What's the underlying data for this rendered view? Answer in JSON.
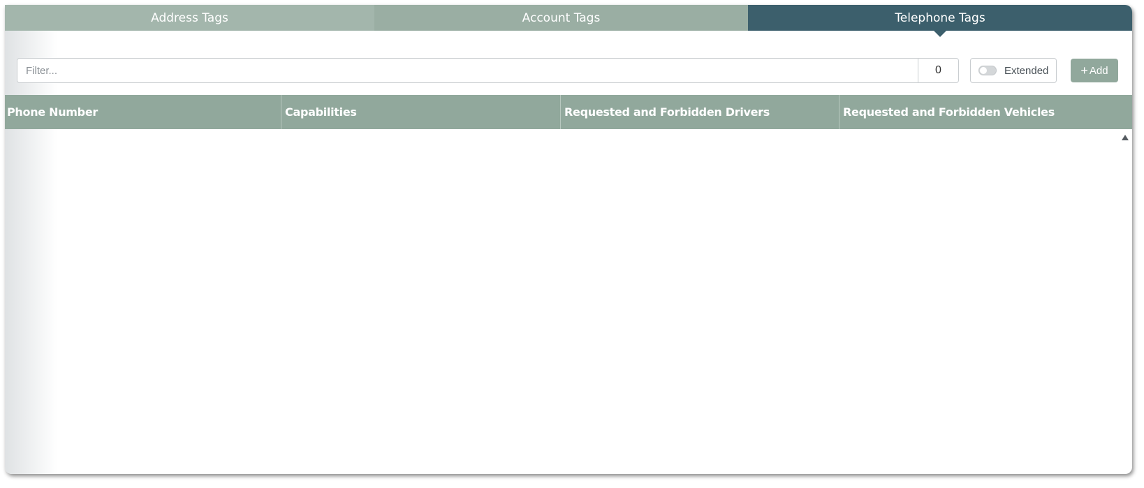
{
  "tabs": [
    {
      "label": "Address Tags",
      "active": false
    },
    {
      "label": "Account Tags",
      "active": false
    },
    {
      "label": "Telephone Tags",
      "active": true
    }
  ],
  "toolbar": {
    "filter_placeholder": "Filter...",
    "filter_value": "",
    "count": "0",
    "extended_label": "Extended",
    "extended_on": false,
    "add_label": "Add",
    "add_icon": "plus-icon"
  },
  "table": {
    "columns": [
      "Phone Number",
      "Capabilities",
      "Requested and Forbidden Drivers",
      "Requested and Forbidden Vehicles"
    ],
    "rows": []
  },
  "colors": {
    "tab_inactive_light": "#a3b6ac",
    "tab_inactive": "#9aaea3",
    "tab_active": "#3c5f6c",
    "header_bg": "#91a89c",
    "accent_button": "#91a89c"
  }
}
